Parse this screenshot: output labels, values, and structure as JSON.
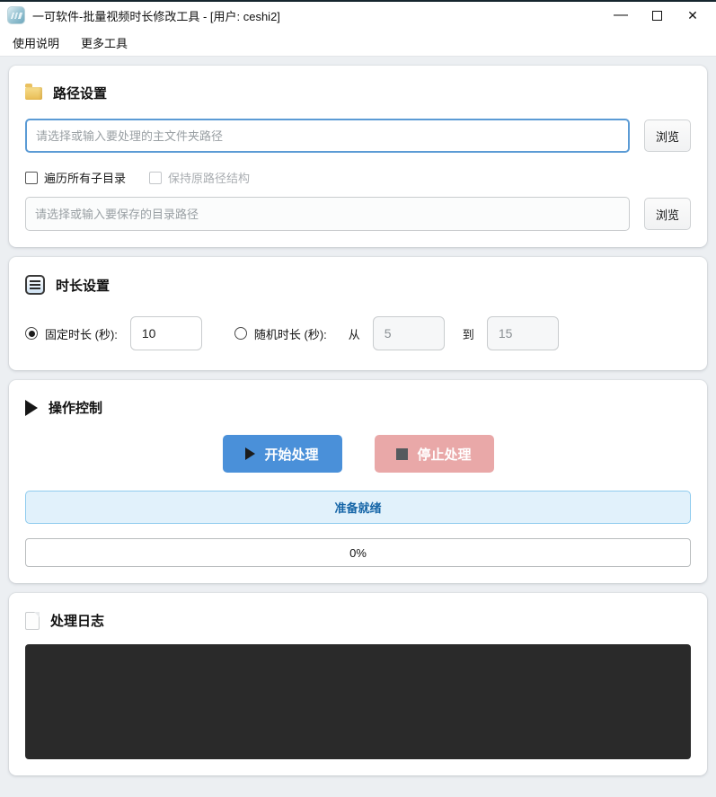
{
  "window": {
    "title": "一可软件-批量视频时长修改工具 - [用户: ceshi2]",
    "controls": {
      "minimize": "—",
      "close": "✕"
    }
  },
  "menu": {
    "items": [
      {
        "label": "使用说明"
      },
      {
        "label": "更多工具"
      }
    ]
  },
  "path_section": {
    "title": "路径设置",
    "source_input": {
      "value": "",
      "placeholder": "请选择或输入要处理的主文件夹路径"
    },
    "source_browse_label": "浏览",
    "checkbox_recursive": {
      "label": "遍历所有子目录",
      "checked": false
    },
    "checkbox_keep_structure": {
      "label": "保持原路径结构",
      "checked": false,
      "disabled": true
    },
    "output_input": {
      "value": "",
      "placeholder": "请选择或输入要保存的目录路径"
    },
    "output_browse_label": "浏览"
  },
  "duration_section": {
    "title": "时长设置",
    "fixed_radio": {
      "label": "固定时长 (秒):",
      "selected": true
    },
    "fixed_value": "10",
    "random_radio": {
      "label": "随机时长 (秒):",
      "selected": false
    },
    "from_label": "从",
    "random_min": "5",
    "to_label": "到",
    "random_max": "15"
  },
  "control_section": {
    "title": "操作控制",
    "start_button_label": "开始处理",
    "stop_button_label": "停止处理",
    "status_text": "准备就绪",
    "progress_text": "0%"
  },
  "log_section": {
    "title": "处理日志",
    "content": ""
  },
  "colors": {
    "accent_blue": "#4a90d9",
    "stop_pink": "#e9a8a8",
    "status_bg": "#e1f1fb",
    "status_border": "#8ecbee",
    "status_text": "#1565a7",
    "log_bg": "#2a2a2a",
    "focused_input_border": "#5b9bd5"
  }
}
